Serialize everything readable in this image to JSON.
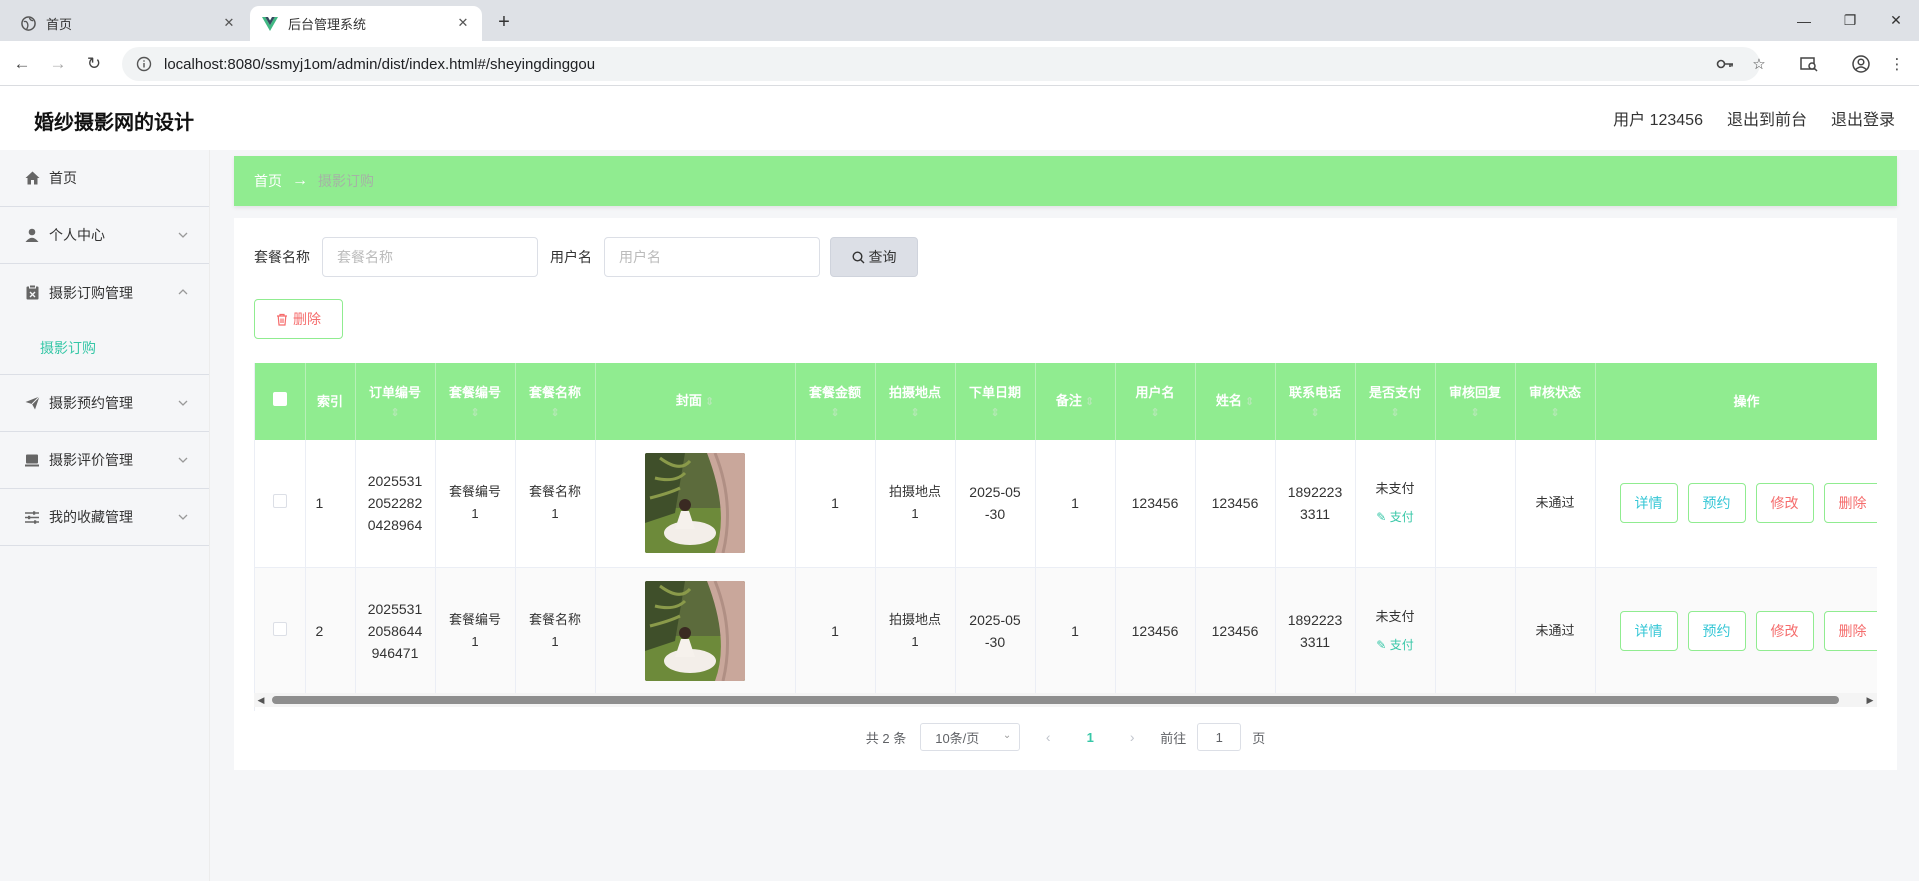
{
  "browser": {
    "tabs": [
      {
        "title": "首页",
        "active": false
      },
      {
        "title": "后台管理系统",
        "active": true
      }
    ],
    "url": "localhost:8080/ssmyj1om/admin/dist/index.html#/sheyingdinggou"
  },
  "header": {
    "brand": "婚纱摄影网的设计",
    "user": "用户 123456",
    "to_front": "退出到前台",
    "logout": "退出登录"
  },
  "sidebar": {
    "items": [
      {
        "label": "首页",
        "icon": "home-icon"
      },
      {
        "label": "个人中心",
        "icon": "user-icon"
      },
      {
        "label": "摄影订购管理",
        "icon": "clipboard-icon"
      },
      {
        "label": "摄影订购",
        "sub": true
      },
      {
        "label": "摄影预约管理",
        "icon": "send-icon"
      },
      {
        "label": "摄影评价管理",
        "icon": "card-icon"
      },
      {
        "label": "我的收藏管理",
        "icon": "sliders-icon"
      }
    ]
  },
  "breadcrumb": {
    "home": "首页",
    "arrow": "→",
    "current": "摄影订购"
  },
  "search": {
    "pkg_label": "套餐名称",
    "pkg_placeholder": "套餐名称",
    "user_label": "用户名",
    "user_placeholder": "用户名",
    "query_btn": "查询"
  },
  "delete_btn": "删除",
  "table": {
    "columns": [
      "索引",
      "订单编号",
      "套餐编号",
      "套餐名称",
      "封面",
      "套餐金额",
      "拍摄地点",
      "下单日期",
      "备注",
      "用户名",
      "姓名",
      "联系电话",
      "是否支付",
      "审核回复",
      "审核状态",
      "操作"
    ],
    "rows": [
      {
        "index": "1",
        "order_no": "20255312052282 0428964",
        "order_no_lines": [
          "2025531",
          "2052282",
          "0428964"
        ],
        "pkg_no": "套餐编号1",
        "pkg_no_lines": [
          "套餐编号",
          "1"
        ],
        "pkg_name_lines": [
          "套餐名称",
          "1"
        ],
        "amount": "1",
        "place_lines": [
          "拍摄地点",
          "1"
        ],
        "date_lines": [
          "2025-05",
          "-30"
        ],
        "remark": "1",
        "username": "123456",
        "name": "123456",
        "phone_lines": [
          "1892223",
          "3311"
        ],
        "paid": "未支付",
        "pay_link": "支付",
        "reply": "",
        "status": "未通过"
      },
      {
        "index": "2",
        "order_no_lines": [
          "2025531",
          "2058644",
          "946471"
        ],
        "pkg_no_lines": [
          "套餐编号",
          "1"
        ],
        "pkg_name_lines": [
          "套餐名称",
          "1"
        ],
        "amount": "1",
        "place_lines": [
          "拍摄地点",
          "1"
        ],
        "date_lines": [
          "2025-05",
          "-30"
        ],
        "remark": "1",
        "username": "123456",
        "name": "123456",
        "phone_lines": [
          "1892223",
          "3311"
        ],
        "paid": "未支付",
        "pay_link": "支付",
        "reply": "",
        "status": "未通过"
      }
    ],
    "actions": {
      "detail": "详情",
      "book": "预约",
      "edit": "修改",
      "delete": "删除"
    }
  },
  "pager": {
    "total": "共 2 条",
    "page_size": "10条/页",
    "current": "1",
    "goto_label": "前往",
    "goto_value": "1",
    "page_suffix": "页"
  },
  "colors": {
    "accent": "#90ec90",
    "link": "#37c7a7",
    "danger": "#f56c6c"
  }
}
